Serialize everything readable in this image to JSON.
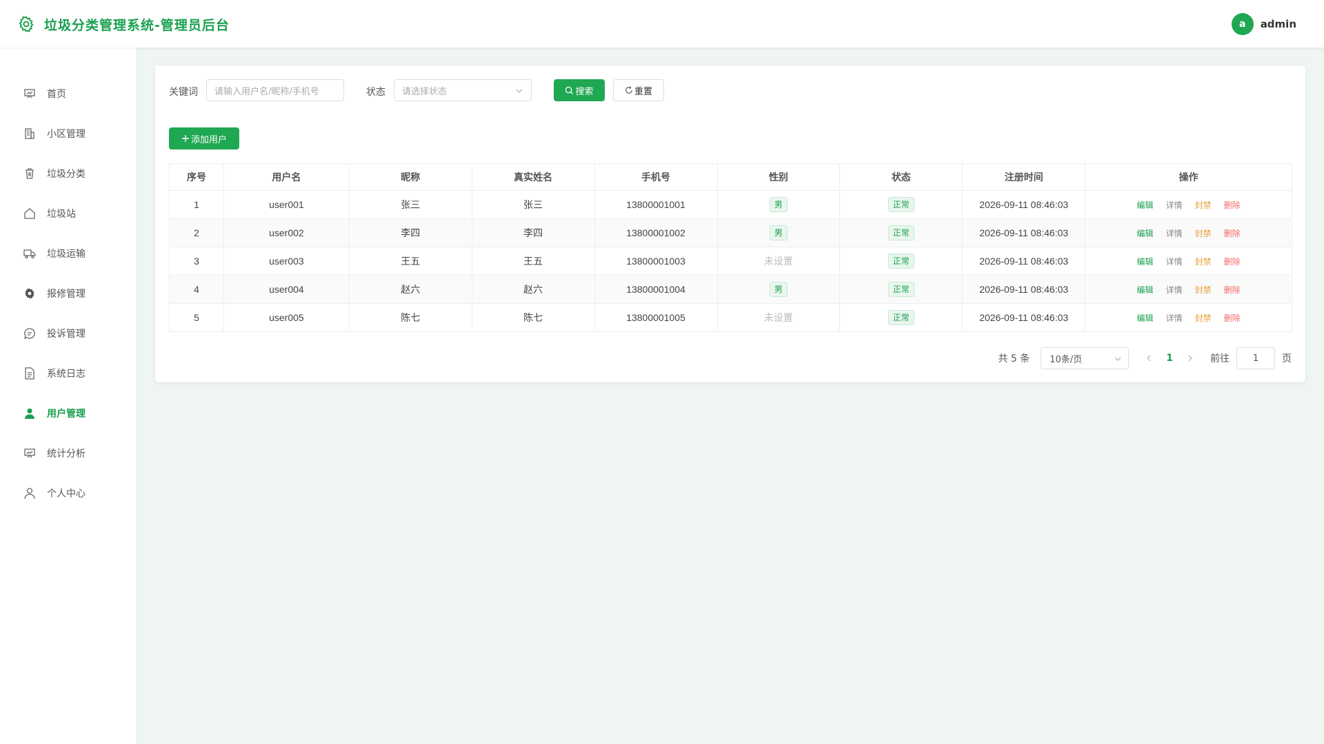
{
  "app": {
    "title": "垃圾分类管理系统-管理员后台"
  },
  "user": {
    "avatar_letter": "a",
    "name": "admin"
  },
  "sidebar": {
    "items": [
      {
        "label": "首页",
        "icon": "dashboard-icon"
      },
      {
        "label": "小区管理",
        "icon": "building-icon"
      },
      {
        "label": "垃圾分类",
        "icon": "trash-icon"
      },
      {
        "label": "垃圾站",
        "icon": "house-icon"
      },
      {
        "label": "垃圾运输",
        "icon": "truck-icon"
      },
      {
        "label": "报修管理",
        "icon": "gear-icon"
      },
      {
        "label": "投诉管理",
        "icon": "chat-icon"
      },
      {
        "label": "系统日志",
        "icon": "document-icon"
      },
      {
        "label": "用户管理",
        "icon": "user-icon",
        "active": true
      },
      {
        "label": "统计分析",
        "icon": "chart-board-icon"
      },
      {
        "label": "个人中心",
        "icon": "person-icon"
      }
    ]
  },
  "search": {
    "keyword_label": "关键词",
    "keyword_placeholder": "请输入用户名/昵称/手机号",
    "status_label": "状态",
    "status_placeholder": "请选择状态",
    "search_button": "搜索",
    "reset_button": "重置"
  },
  "toolbar": {
    "add_user_button": "添加用户"
  },
  "table": {
    "columns": [
      "序号",
      "用户名",
      "昵称",
      "真实姓名",
      "手机号",
      "性别",
      "状态",
      "注册时间",
      "操作"
    ],
    "rows": [
      {
        "index": "1",
        "username": "user001",
        "nickname": "张三",
        "realname": "张三",
        "phone": "13800001001",
        "gender": "男",
        "status": "正常",
        "registered": "2026-09-11 08:46:03"
      },
      {
        "index": "2",
        "username": "user002",
        "nickname": "李四",
        "realname": "李四",
        "phone": "13800001002",
        "gender": "男",
        "status": "正常",
        "registered": "2026-09-11 08:46:03"
      },
      {
        "index": "3",
        "username": "user003",
        "nickname": "王五",
        "realname": "王五",
        "phone": "13800001003",
        "gender": "未设置",
        "status": "正常",
        "registered": "2026-09-11 08:46:03"
      },
      {
        "index": "4",
        "username": "user004",
        "nickname": "赵六",
        "realname": "赵六",
        "phone": "13800001004",
        "gender": "男",
        "status": "正常",
        "registered": "2026-09-11 08:46:03"
      },
      {
        "index": "5",
        "username": "user005",
        "nickname": "陈七",
        "realname": "陈七",
        "phone": "13800001005",
        "gender": "未设置",
        "status": "正常",
        "registered": "2026-09-11 08:46:03"
      }
    ],
    "actions": {
      "edit": "编辑",
      "detail": "详情",
      "ban": "封禁",
      "delete": "删除"
    }
  },
  "pagination": {
    "total_text": "共 5 条",
    "page_size": "10条/页",
    "current_page": "1",
    "goto_label": "前往",
    "goto_value": "1",
    "page_suffix": "页"
  },
  "colors": {
    "accent": "#1fa752",
    "edit": "#1aa04f",
    "detail": "#888888",
    "ban": "#e6a23c",
    "delete": "#f56c6c"
  }
}
